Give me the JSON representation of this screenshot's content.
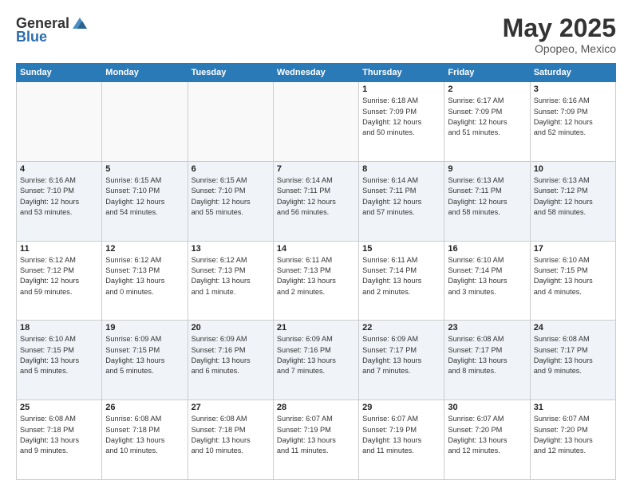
{
  "header": {
    "logo_general": "General",
    "logo_blue": "Blue",
    "month": "May 2025",
    "location": "Opopeo, Mexico"
  },
  "weekdays": [
    "Sunday",
    "Monday",
    "Tuesday",
    "Wednesday",
    "Thursday",
    "Friday",
    "Saturday"
  ],
  "weeks": [
    [
      {
        "day": "",
        "info": ""
      },
      {
        "day": "",
        "info": ""
      },
      {
        "day": "",
        "info": ""
      },
      {
        "day": "",
        "info": ""
      },
      {
        "day": "1",
        "info": "Sunrise: 6:18 AM\nSunset: 7:09 PM\nDaylight: 12 hours\nand 50 minutes."
      },
      {
        "day": "2",
        "info": "Sunrise: 6:17 AM\nSunset: 7:09 PM\nDaylight: 12 hours\nand 51 minutes."
      },
      {
        "day": "3",
        "info": "Sunrise: 6:16 AM\nSunset: 7:09 PM\nDaylight: 12 hours\nand 52 minutes."
      }
    ],
    [
      {
        "day": "4",
        "info": "Sunrise: 6:16 AM\nSunset: 7:10 PM\nDaylight: 12 hours\nand 53 minutes."
      },
      {
        "day": "5",
        "info": "Sunrise: 6:15 AM\nSunset: 7:10 PM\nDaylight: 12 hours\nand 54 minutes."
      },
      {
        "day": "6",
        "info": "Sunrise: 6:15 AM\nSunset: 7:10 PM\nDaylight: 12 hours\nand 55 minutes."
      },
      {
        "day": "7",
        "info": "Sunrise: 6:14 AM\nSunset: 7:11 PM\nDaylight: 12 hours\nand 56 minutes."
      },
      {
        "day": "8",
        "info": "Sunrise: 6:14 AM\nSunset: 7:11 PM\nDaylight: 12 hours\nand 57 minutes."
      },
      {
        "day": "9",
        "info": "Sunrise: 6:13 AM\nSunset: 7:11 PM\nDaylight: 12 hours\nand 58 minutes."
      },
      {
        "day": "10",
        "info": "Sunrise: 6:13 AM\nSunset: 7:12 PM\nDaylight: 12 hours\nand 58 minutes."
      }
    ],
    [
      {
        "day": "11",
        "info": "Sunrise: 6:12 AM\nSunset: 7:12 PM\nDaylight: 12 hours\nand 59 minutes."
      },
      {
        "day": "12",
        "info": "Sunrise: 6:12 AM\nSunset: 7:13 PM\nDaylight: 13 hours\nand 0 minutes."
      },
      {
        "day": "13",
        "info": "Sunrise: 6:12 AM\nSunset: 7:13 PM\nDaylight: 13 hours\nand 1 minute."
      },
      {
        "day": "14",
        "info": "Sunrise: 6:11 AM\nSunset: 7:13 PM\nDaylight: 13 hours\nand 2 minutes."
      },
      {
        "day": "15",
        "info": "Sunrise: 6:11 AM\nSunset: 7:14 PM\nDaylight: 13 hours\nand 2 minutes."
      },
      {
        "day": "16",
        "info": "Sunrise: 6:10 AM\nSunset: 7:14 PM\nDaylight: 13 hours\nand 3 minutes."
      },
      {
        "day": "17",
        "info": "Sunrise: 6:10 AM\nSunset: 7:15 PM\nDaylight: 13 hours\nand 4 minutes."
      }
    ],
    [
      {
        "day": "18",
        "info": "Sunrise: 6:10 AM\nSunset: 7:15 PM\nDaylight: 13 hours\nand 5 minutes."
      },
      {
        "day": "19",
        "info": "Sunrise: 6:09 AM\nSunset: 7:15 PM\nDaylight: 13 hours\nand 5 minutes."
      },
      {
        "day": "20",
        "info": "Sunrise: 6:09 AM\nSunset: 7:16 PM\nDaylight: 13 hours\nand 6 minutes."
      },
      {
        "day": "21",
        "info": "Sunrise: 6:09 AM\nSunset: 7:16 PM\nDaylight: 13 hours\nand 7 minutes."
      },
      {
        "day": "22",
        "info": "Sunrise: 6:09 AM\nSunset: 7:17 PM\nDaylight: 13 hours\nand 7 minutes."
      },
      {
        "day": "23",
        "info": "Sunrise: 6:08 AM\nSunset: 7:17 PM\nDaylight: 13 hours\nand 8 minutes."
      },
      {
        "day": "24",
        "info": "Sunrise: 6:08 AM\nSunset: 7:17 PM\nDaylight: 13 hours\nand 9 minutes."
      }
    ],
    [
      {
        "day": "25",
        "info": "Sunrise: 6:08 AM\nSunset: 7:18 PM\nDaylight: 13 hours\nand 9 minutes."
      },
      {
        "day": "26",
        "info": "Sunrise: 6:08 AM\nSunset: 7:18 PM\nDaylight: 13 hours\nand 10 minutes."
      },
      {
        "day": "27",
        "info": "Sunrise: 6:08 AM\nSunset: 7:18 PM\nDaylight: 13 hours\nand 10 minutes."
      },
      {
        "day": "28",
        "info": "Sunrise: 6:07 AM\nSunset: 7:19 PM\nDaylight: 13 hours\nand 11 minutes."
      },
      {
        "day": "29",
        "info": "Sunrise: 6:07 AM\nSunset: 7:19 PM\nDaylight: 13 hours\nand 11 minutes."
      },
      {
        "day": "30",
        "info": "Sunrise: 6:07 AM\nSunset: 7:20 PM\nDaylight: 13 hours\nand 12 minutes."
      },
      {
        "day": "31",
        "info": "Sunrise: 6:07 AM\nSunset: 7:20 PM\nDaylight: 13 hours\nand 12 minutes."
      }
    ]
  ]
}
